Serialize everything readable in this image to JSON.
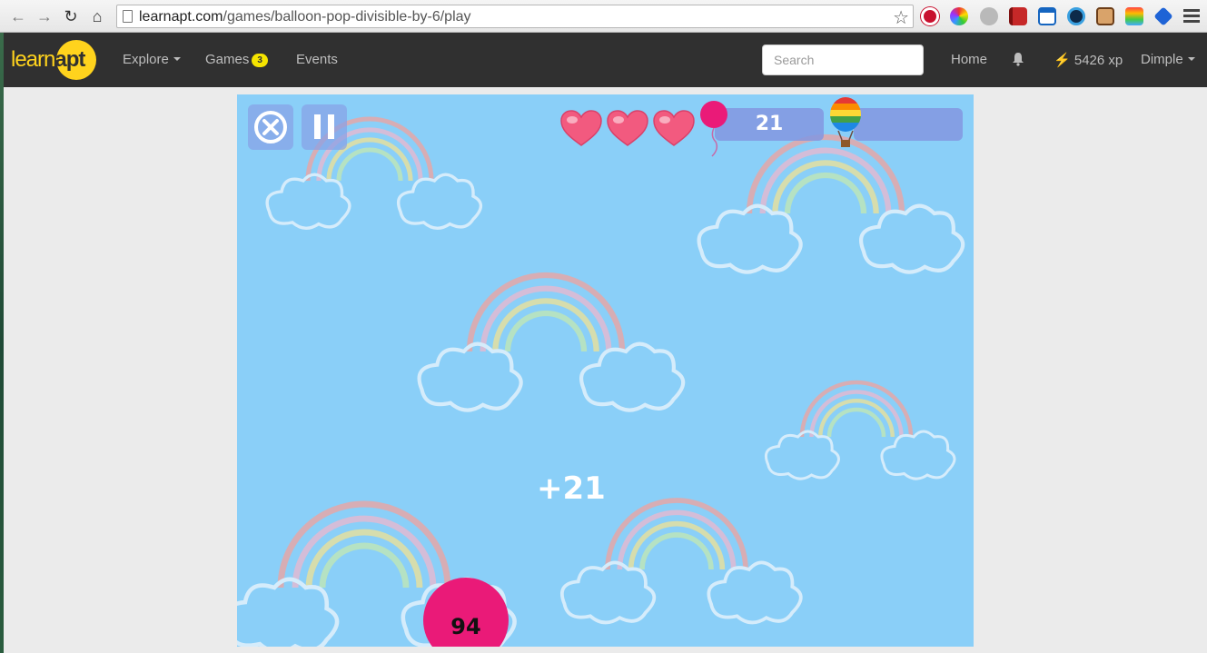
{
  "browser": {
    "url_domain": "learnapt.com",
    "url_path": "/games/balloon-pop-divisible-by-6/play",
    "extensions": [
      "stop-sign-icon",
      "color-wheel-icon",
      "alien-icon",
      "red-book-icon",
      "window-icon",
      "eye-icon",
      "toast-icon",
      "rainbow-icon",
      "blue-diamond-icon"
    ]
  },
  "navbar": {
    "logo_prefix": "learn",
    "logo_suffix": "apt",
    "explore_label": "Explore",
    "games_label": "Games",
    "games_badge": "3",
    "events_label": "Events",
    "search_placeholder": "Search",
    "home_label": "Home",
    "xp_label": "5426 xp",
    "user_label": "Dimple"
  },
  "game": {
    "lives": 3,
    "score": "21",
    "points_popup": "+21",
    "balloon_number": "94",
    "colors": {
      "sky": "#8acff8",
      "balloon": "#ea1a78",
      "heart": "#f25a7f",
      "hud": "#8296e1"
    }
  }
}
